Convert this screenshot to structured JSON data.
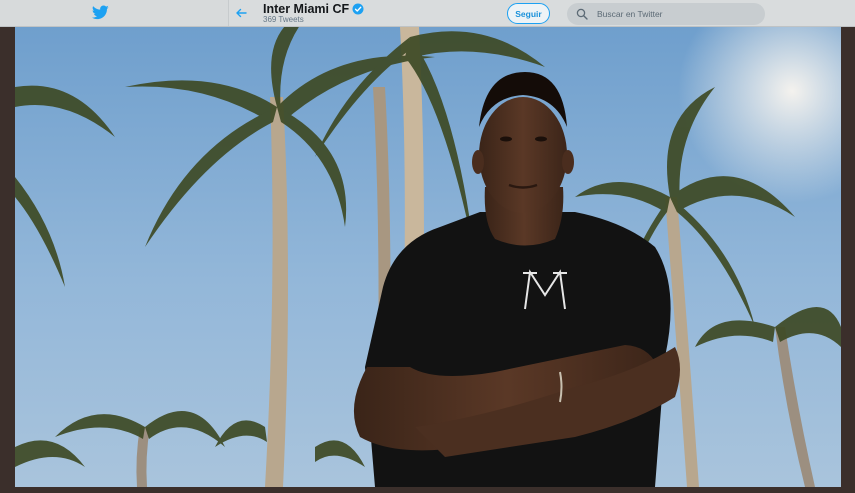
{
  "header": {
    "profile_name": "Inter Miami CF",
    "tweet_count": "369 Tweets",
    "follow_label": "Seguir",
    "search": {
      "placeholder": "Buscar en Twitter"
    }
  },
  "icons": {
    "logo": "twitter-bird-icon",
    "back": "arrow-left-icon",
    "verified": "verified-badge-icon",
    "search": "search-icon"
  },
  "banner": {
    "shirt_logo": "M"
  },
  "colors": {
    "accent": "#1da1f2",
    "topbar": "#d9dcdd",
    "frame": "#3b2f2b"
  }
}
